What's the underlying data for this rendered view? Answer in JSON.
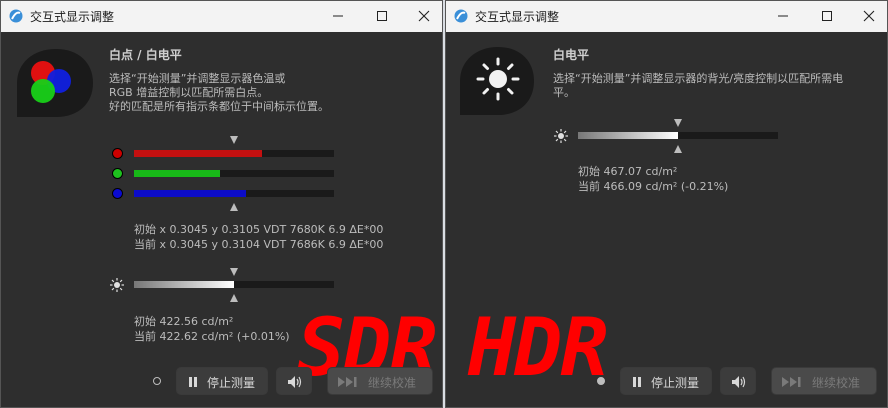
{
  "colors": {
    "accent_red": "#cc0000",
    "accent_green": "#1ec21e",
    "accent_blue": "#0a0ad0",
    "overlay_text": "#ff0000"
  },
  "sdr_window": {
    "title": "交互式显示调整",
    "heading": "白点 / 白电平",
    "description": [
      "选择“开始测量”并调整显示器色温或",
      "RGB 增益控制以匹配所需白点。",
      "好的匹配是所有指示条都位于中间标示位置。"
    ],
    "rgb_bars": [
      {
        "channel": "red",
        "level_percent": 64
      },
      {
        "channel": "green",
        "level_percent": 43
      },
      {
        "channel": "blue",
        "level_percent": 56
      }
    ],
    "whitepoint_initial": "初始 x 0.3045 y 0.3105 VDT 7680K 6.9 ΔE*00",
    "whitepoint_current": "当前 x 0.3045 y 0.3104 VDT 7686K 6.9 ΔE*00",
    "luminance_bar_level_percent": 50,
    "luminance_initial": "初始 422.56 cd/m²",
    "luminance_current": "当前 422.62 cd/m² (+0.01%)",
    "stop_button": "停止测量",
    "continue_button": "继续校准",
    "overlay_label": "SDR"
  },
  "hdr_window": {
    "title": "交互式显示调整",
    "heading": "白电平",
    "description": [
      "选择“开始测量”并调整显示器的背光/亮度控制以匹配所需电",
      "平。"
    ],
    "luminance_bar_level_percent": 50,
    "luminance_initial": "初始 467.07 cd/m²",
    "luminance_current": "当前 466.09 cd/m² (-0.21%)",
    "stop_button": "停止测量",
    "continue_button": "继续校准",
    "overlay_label": "HDR"
  }
}
